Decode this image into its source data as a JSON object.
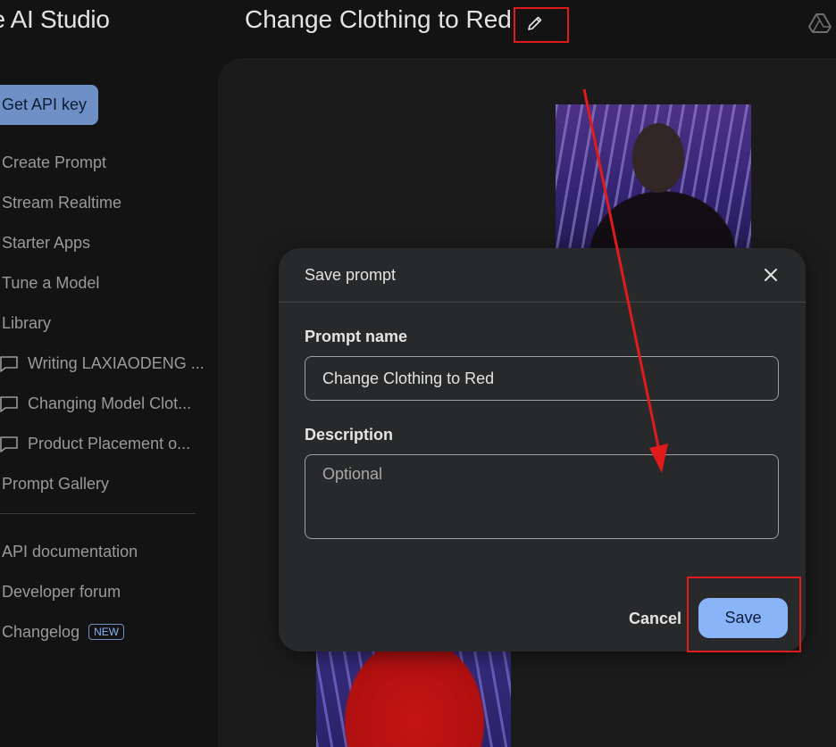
{
  "header": {
    "app_title": "ogle AI Studio",
    "prompt_title": "Change Clothing to Red"
  },
  "sidebar": {
    "api_key_button": "Get API key",
    "nav": [
      {
        "label": "Create Prompt"
      },
      {
        "label": "Stream Realtime"
      },
      {
        "label": "Starter Apps"
      },
      {
        "label": "Tune a Model"
      },
      {
        "label": "Library"
      }
    ],
    "library_items": [
      {
        "label": "Writing LAXIAODENG ..."
      },
      {
        "label": "Changing Model Clot..."
      },
      {
        "label": "Product Placement o..."
      }
    ],
    "gallery": "Prompt Gallery",
    "footer_links": [
      {
        "label": "API documentation"
      },
      {
        "label": "Developer forum"
      },
      {
        "label": "Changelog"
      }
    ],
    "new_badge": "NEW"
  },
  "dialog": {
    "title": "Save prompt",
    "name_label": "Prompt name",
    "name_value": "Change Clothing to Red",
    "description_label": "Description",
    "description_placeholder": "Optional",
    "cancel_label": "Cancel",
    "save_label": "Save"
  },
  "colors": {
    "accent": "#8ab4f8",
    "annotation": "#e01b1b",
    "background": "#131314",
    "dialog": "#28292b"
  },
  "icons": {
    "edit": "pencil-icon",
    "close": "close-icon",
    "drive": "drive-icon",
    "chat": "chat-bubble-icon"
  }
}
